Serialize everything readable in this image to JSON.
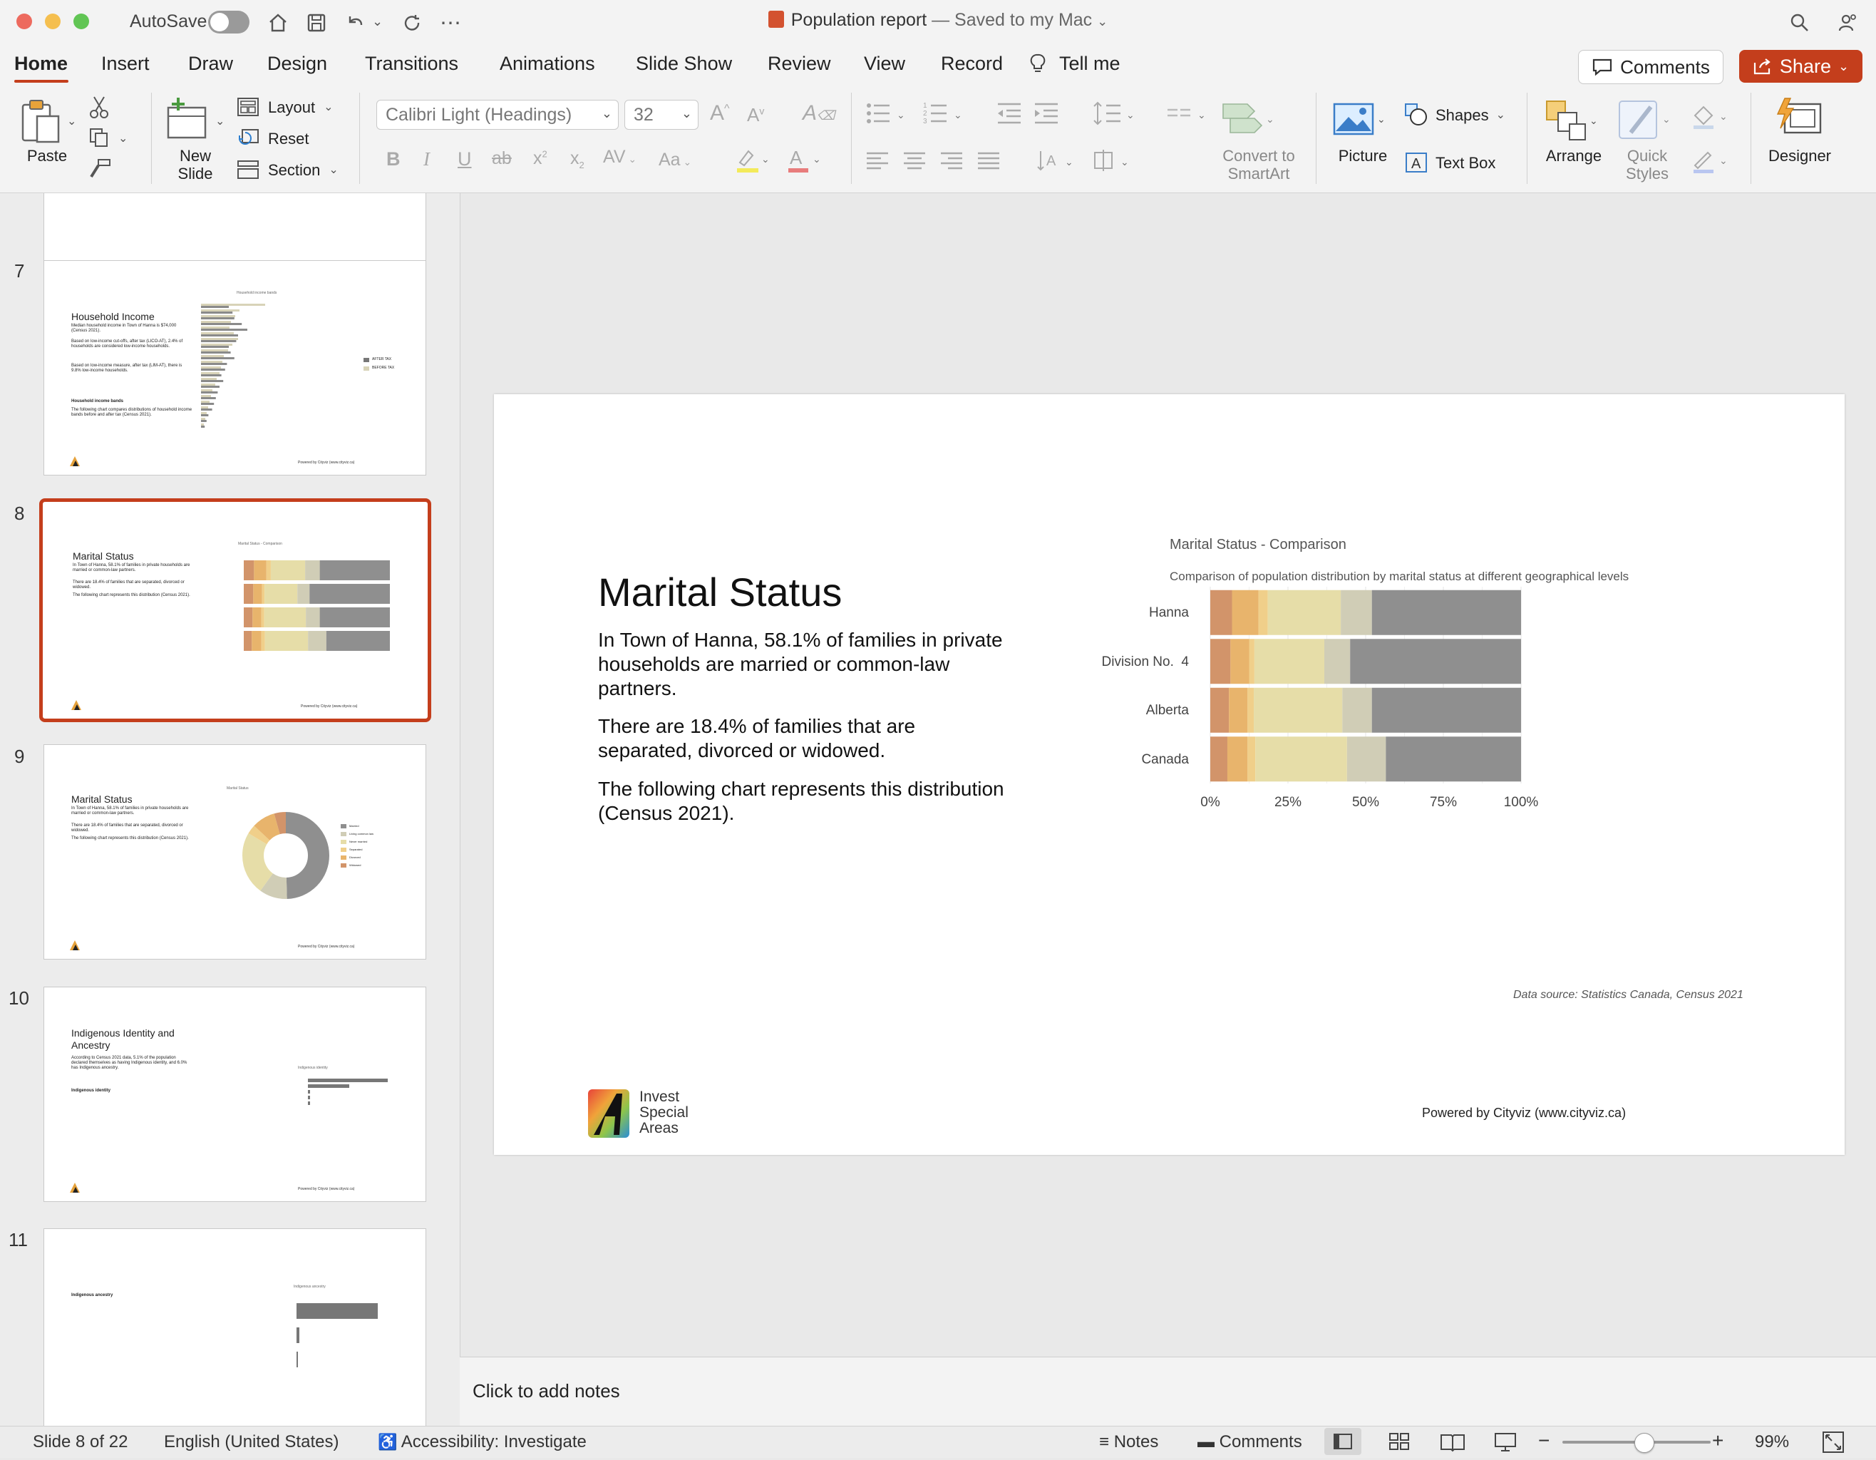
{
  "window": {
    "doc_title": "Population report",
    "save_status": "— Saved to my Mac",
    "autosave_label": "AutoSave",
    "icon_home": "home-icon",
    "icon_save": "save-icon"
  },
  "tabs": [
    "Home",
    "Insert",
    "Draw",
    "Design",
    "Transitions",
    "Animations",
    "Slide Show",
    "Review",
    "View",
    "Record",
    "Tell me"
  ],
  "header_buttons": {
    "comments": "Comments",
    "share": "Share"
  },
  "ribbon": {
    "paste": "Paste",
    "new_slide": [
      "New",
      "Slide"
    ],
    "layout": "Layout",
    "reset": "Reset",
    "section": "Section",
    "font_name": "Calibri Light (Headings)",
    "font_size": "32",
    "convert_smartart": [
      "Convert to",
      "SmartArt"
    ],
    "picture": "Picture",
    "shapes": "Shapes",
    "text_box": "Text Box",
    "arrange": "Arrange",
    "quick_styles": [
      "Quick",
      "Styles"
    ],
    "designer": "Designer"
  },
  "thumbnails": {
    "numbers": [
      "7",
      "8",
      "9",
      "10",
      "11"
    ],
    "s7": {
      "title": "Household Income",
      "p1": "Median household income in Town of Hanna is $74,000 (Census 2021).",
      "p2": "Based on low-income cut-offs, after tax (LICO-AT), 2.4% of households are considered low-income households.",
      "p3": "Based on low-income measure, after tax (LIM-AT), there is 9.8% low-income households.",
      "sub": "Household income bands",
      "p4": "The following chart compares distributions of household income bands before and after tax (Census 2021).",
      "chart_title": "Household income bands",
      "legend": [
        "AFTER TAX",
        "BEFORE TAX"
      ]
    },
    "s8": {
      "title": "Marital Status",
      "p1": "In Town of Hanna, 58.1% of families in private households are married or common-law partners.",
      "p2": "There are 18.4% of families that are separated, divorced or widowed.",
      "p3": "The following chart represents this distribution (Census 2021).",
      "chart_title": "Marital Status - Comparison"
    },
    "s9": {
      "title": "Marital Status",
      "p1": "In Town of Hanna, 58.1% of families in private households are married or common-law partners.",
      "p2": "There are 18.4% of families that are separated, divorced or widowed.",
      "p3": "The following chart represents this distribution (Census 2021).",
      "chart_title": "Marital Status",
      "legend": [
        "Married",
        "Living common law",
        "Never married",
        "Separated",
        "Divorced",
        "Widowed"
      ]
    },
    "s10": {
      "title": "Indigenous Identity and Ancestry",
      "p1": "According to Census 2021 data, 5.1% of the population declared themselves as having Indigenous identity, and 6.0% has Indigenous ancestry.",
      "sub": "Indigenous identity",
      "chart_title": "Indigenous identity"
    },
    "s11": {
      "sub": "Indigenous ancestry",
      "chart_title": "Indigenous ancestry"
    },
    "footer": "Powered by Cityviz (www.cityviz.ca)",
    "logo": [
      "Invest",
      "Special",
      "Areas"
    ]
  },
  "slide": {
    "title": "Marital Status",
    "paragraphs": [
      "In Town of Hanna, 58.1% of families in private households are married or common-law partners.",
      "There are 18.4% of families that are separated, divorced or widowed.",
      "The following chart represents this distribution (Census 2021)."
    ],
    "source": "Data source: Statistics Canada, Census 2021",
    "powered": "Powered by Cityviz (www.cityviz.ca)",
    "logo": [
      "Invest",
      "Special",
      "Areas"
    ]
  },
  "chart_data": {
    "type": "bar",
    "orientation": "horizontal-stacked-100",
    "title": "Marital Status - Comparison",
    "subtitle": "Comparison of population distribution by marital status at different geographical levels",
    "categories": [
      "Hanna",
      "Division No.  4",
      "Alberta",
      "Canada"
    ],
    "x_ticks": [
      "0%",
      "25%",
      "50%",
      "75%",
      "100%"
    ],
    "xlim": [
      0,
      100
    ],
    "segment_colors": [
      "#d2946a",
      "#e8b46c",
      "#f0cf8a",
      "#e6dda8",
      "#d0cdb6",
      "#8f8f8f"
    ],
    "series": [
      {
        "values": [
          7.0,
          6.5,
          6.0,
          5.5
        ]
      },
      {
        "values": [
          8.5,
          6.0,
          6.0,
          6.5
        ]
      },
      {
        "values": [
          3.0,
          1.7,
          2.0,
          2.5
        ]
      },
      {
        "values": [
          23.5,
          22.5,
          28.5,
          29.5
        ]
      },
      {
        "values": [
          10.0,
          8.3,
          9.5,
          12.5
        ]
      },
      {
        "values": [
          48.0,
          55.0,
          48.0,
          43.5
        ]
      }
    ],
    "grid": true,
    "legend": "none"
  },
  "notes": {
    "placeholder": "Click to add notes"
  },
  "status": {
    "slide_counter": "Slide 8 of 22",
    "language": "English (United States)",
    "accessibility": "Accessibility: Investigate",
    "notes": "Notes",
    "comments": "Comments",
    "zoom": "99%",
    "zoom_fraction": 0.55
  }
}
